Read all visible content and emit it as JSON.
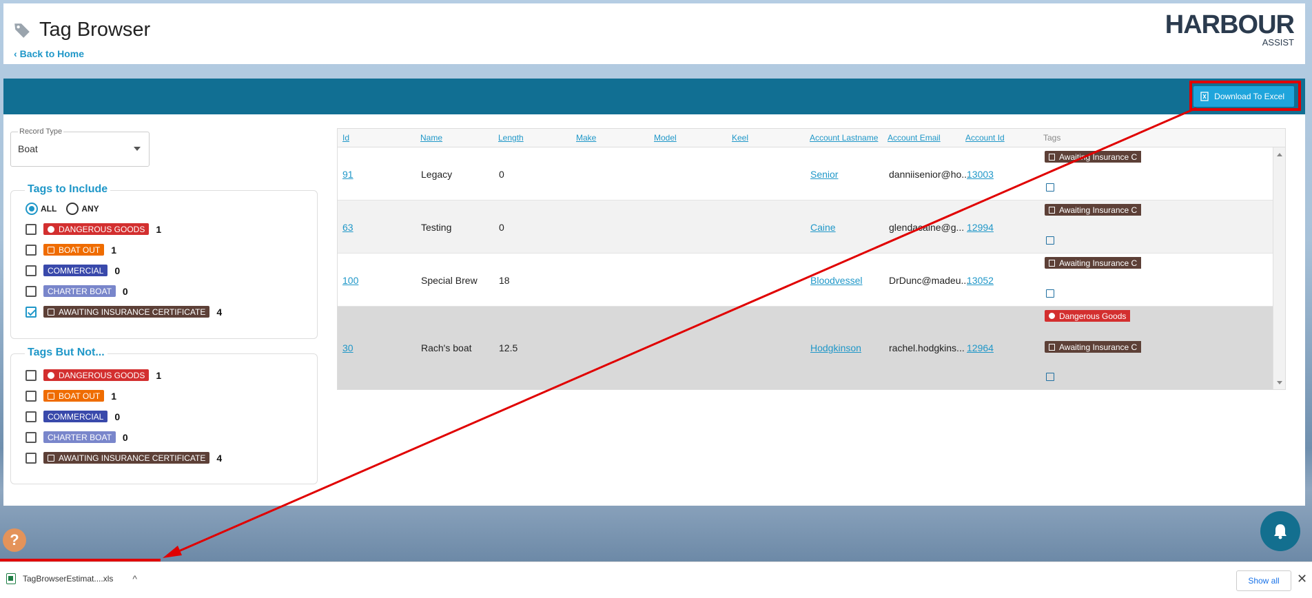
{
  "header": {
    "title": "Tag Browser",
    "back_link": "Back to Home",
    "logo_main": "HARBOUR",
    "logo_sub": "ASSIST"
  },
  "toolbar": {
    "download_label": "Download To Excel"
  },
  "filters": {
    "record_type_label": "Record Type",
    "record_type_value": "Boat",
    "include_legend": "Tags to Include",
    "radio_all": "ALL",
    "radio_any": "ANY",
    "radio_selected": "ALL",
    "include_tags": [
      {
        "label": "DANGEROUS GOODS",
        "count": "1",
        "checked": false
      },
      {
        "label": "BOAT OUT",
        "count": "1",
        "checked": false
      },
      {
        "label": "COMMERCIAL",
        "count": "0",
        "checked": false
      },
      {
        "label": "CHARTER BOAT",
        "count": "0",
        "checked": false
      },
      {
        "label": "AWAITING INSURANCE CERTIFICATE",
        "count": "4",
        "checked": true
      }
    ],
    "exclude_legend": "Tags But Not...",
    "exclude_tags": [
      {
        "label": "DANGEROUS GOODS",
        "count": "1",
        "checked": false
      },
      {
        "label": "BOAT OUT",
        "count": "1",
        "checked": false
      },
      {
        "label": "COMMERCIAL",
        "count": "0",
        "checked": false
      },
      {
        "label": "CHARTER BOAT",
        "count": "0",
        "checked": false
      },
      {
        "label": "AWAITING INSURANCE CERTIFICATE",
        "count": "4",
        "checked": false
      }
    ]
  },
  "colors": {
    "dangerous": "#d32f2f",
    "boat_out": "#ef6c00",
    "commercial": "#3949ab",
    "charter": "#7986cb",
    "awaiting": "#5d4037",
    "accent": "#1f97c8",
    "bar": "#116f93"
  },
  "grid": {
    "columns": [
      "Id",
      "Name",
      "Length",
      "Make",
      "Model",
      "Keel",
      "Account Lastname",
      "Account Email",
      "Account Id",
      "Tags"
    ],
    "rows": [
      {
        "id": "91",
        "name": "Legacy",
        "length": "0",
        "lastname": "Senior",
        "email": "danniisenior@ho...",
        "account_id": "13003",
        "tags": [
          "Awaiting Insurance C"
        ]
      },
      {
        "id": "63",
        "name": "Testing",
        "length": "0",
        "lastname": "Caine",
        "email": "glendacaine@g...",
        "account_id": "12994",
        "tags": [
          "Awaiting Insurance C"
        ]
      },
      {
        "id": "100",
        "name": "Special Brew",
        "length": "18",
        "lastname": "Bloodvessel",
        "email": "DrDunc@madeu...",
        "account_id": "13052",
        "tags": [
          "Awaiting Insurance C"
        ]
      },
      {
        "id": "30",
        "name": "Rach's boat",
        "length": "12.5",
        "lastname": "Hodgkinson",
        "email": "rachel.hodgkins...",
        "account_id": "12964",
        "tags": [
          "Dangerous Goods",
          "Awaiting Insurance C"
        ]
      }
    ]
  },
  "downloads": {
    "file_name": "TagBrowserEstimat....xls",
    "show_all": "Show all",
    "close": "✕"
  },
  "help": "?"
}
